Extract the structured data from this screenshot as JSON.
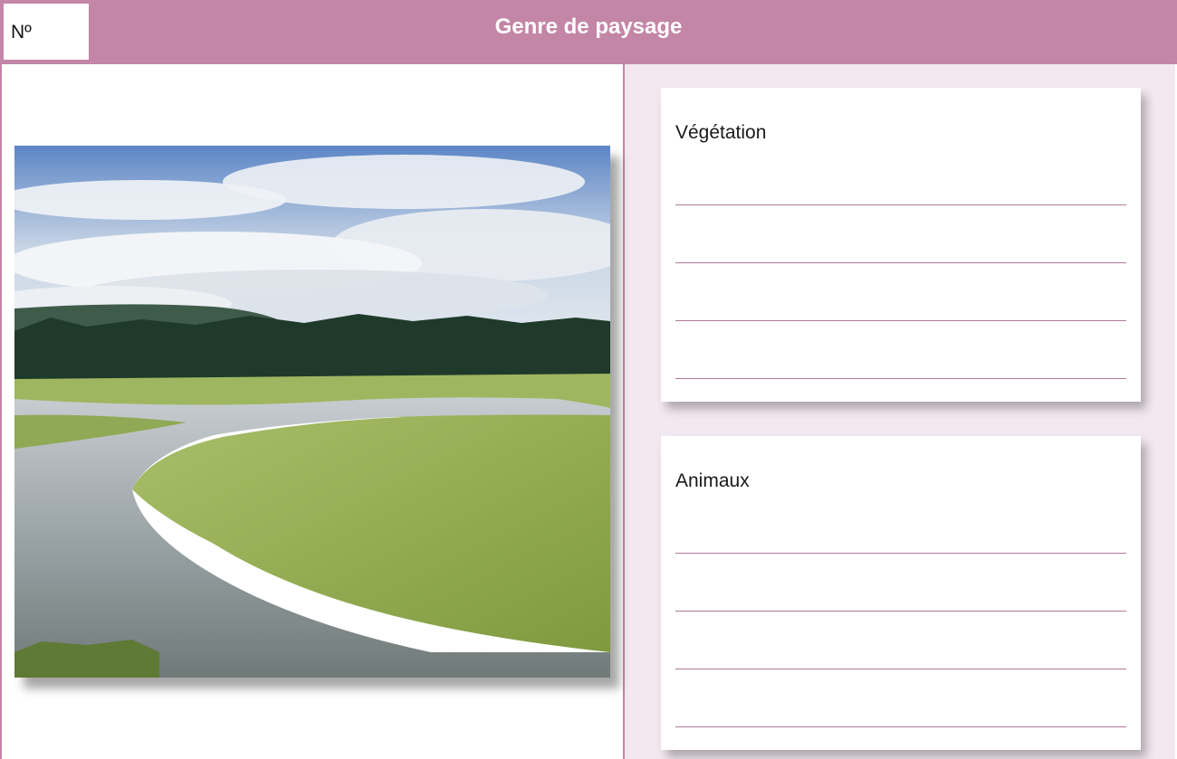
{
  "header": {
    "number_label": "Nº",
    "title": "Genre de paysage"
  },
  "photo": {
    "subject": "landscape-photo"
  },
  "cards": [
    {
      "label": "Végétation"
    },
    {
      "label": "Animaux"
    }
  ],
  "colors": {
    "accent": "#c386a6",
    "panel_bg": "#f3e8f0",
    "rule": "#b07a9c"
  }
}
